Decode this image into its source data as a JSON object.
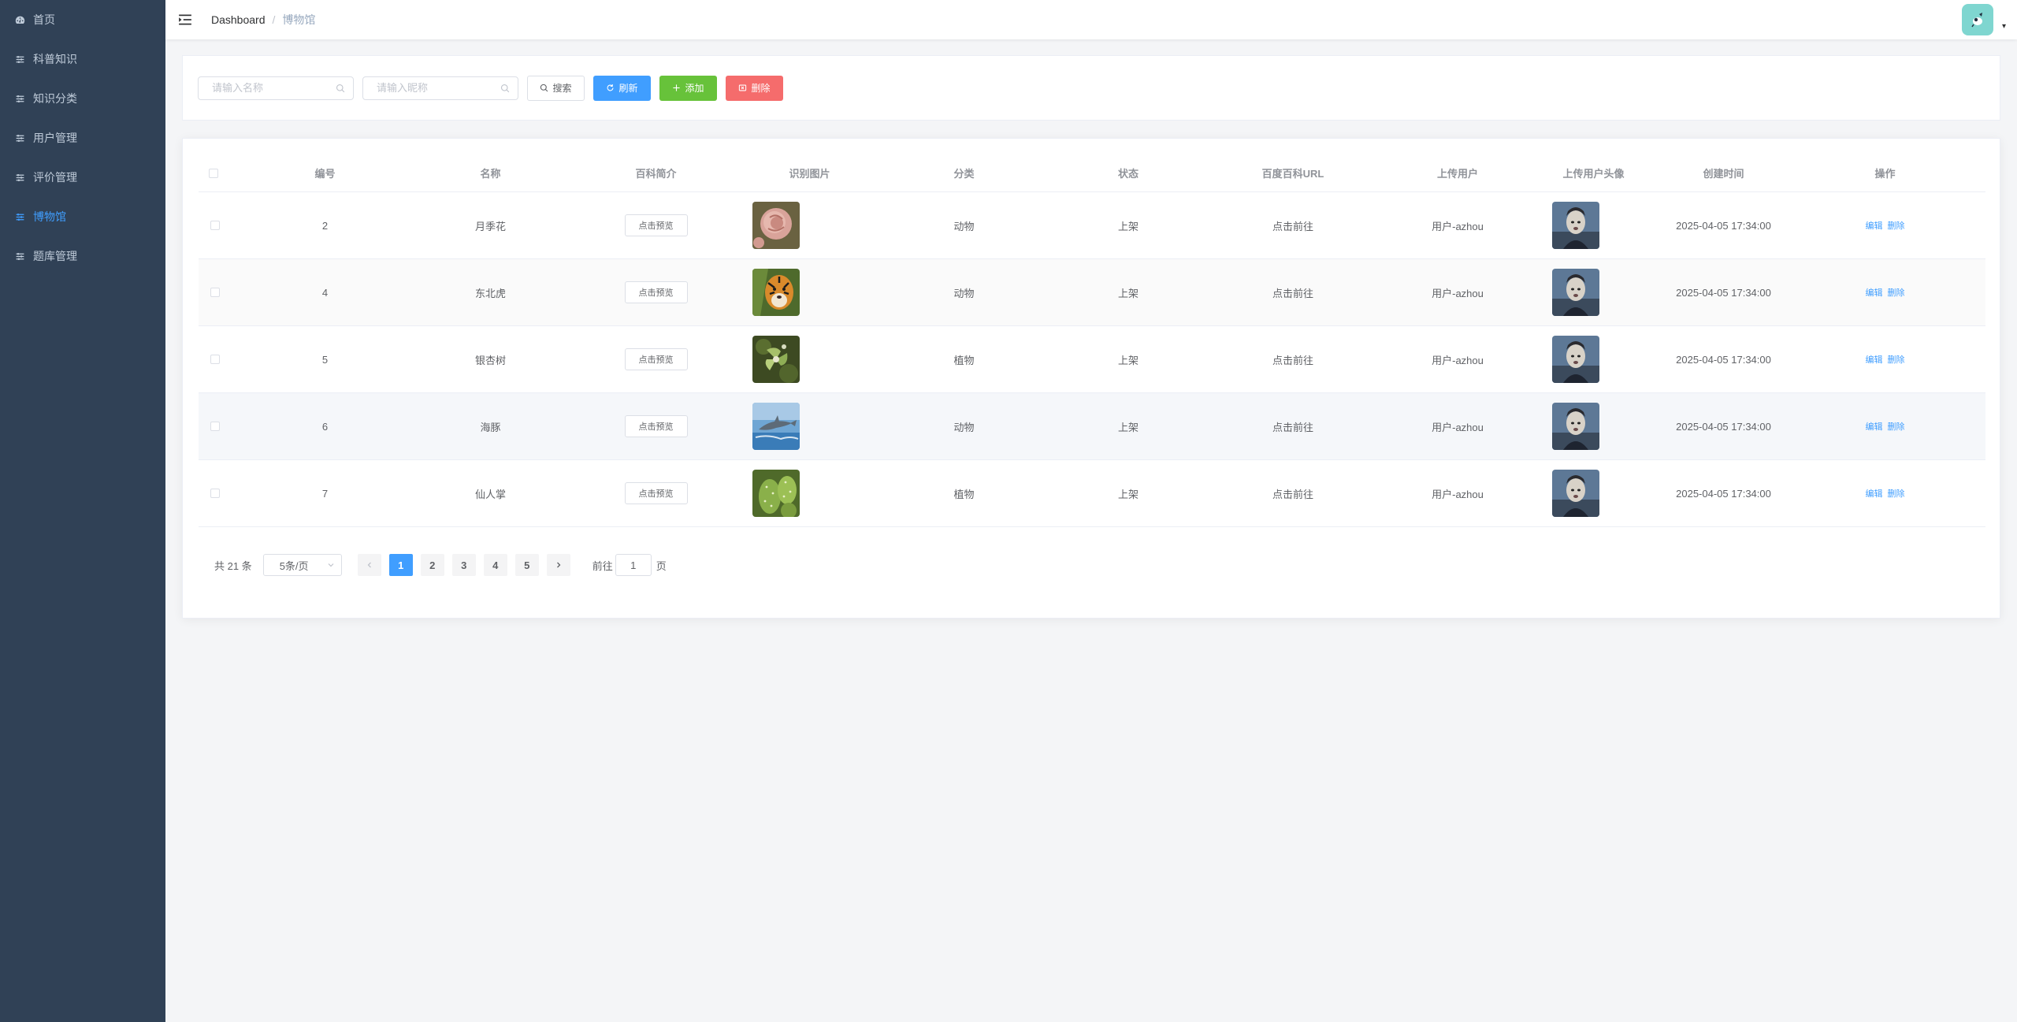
{
  "sidebar": {
    "items": [
      {
        "label": "首页",
        "icon": "dashboard-icon",
        "active": false
      },
      {
        "label": "科普知识",
        "icon": "menu-icon",
        "active": false
      },
      {
        "label": "知识分类",
        "icon": "menu-icon",
        "active": false
      },
      {
        "label": "用户管理",
        "icon": "menu-icon",
        "active": false
      },
      {
        "label": "评价管理",
        "icon": "menu-icon",
        "active": false
      },
      {
        "label": "博物馆",
        "icon": "menu-icon",
        "active": true
      },
      {
        "label": "题库管理",
        "icon": "menu-icon",
        "active": false
      }
    ]
  },
  "header": {
    "breadcrumb_home": "Dashboard",
    "breadcrumb_sep": "/",
    "breadcrumb_current": "博物馆",
    "avatar_caret": "▾"
  },
  "search": {
    "name_placeholder": "请输入名称",
    "nickname_placeholder": "请输入昵称",
    "search_label": "搜索",
    "refresh_label": "刷新",
    "add_label": "添加",
    "delete_label": "删除"
  },
  "table": {
    "headers": {
      "id": "编号",
      "name": "名称",
      "intro": "百科简介",
      "image": "识别图片",
      "category": "分类",
      "status": "状态",
      "url": "百度百科URL",
      "uploader": "上传用户",
      "uploader_avatar": "上传用户头像",
      "created": "创建时间",
      "ops": "操作"
    },
    "rows": [
      {
        "id": "2",
        "name": "月季花",
        "intro_btn": "点击预览",
        "image": "rose",
        "category": "动物",
        "status": "上架",
        "url": "点击前往",
        "uploader": "用户-azhou",
        "created": "2025-04-05 17:34:00",
        "edit": "编辑",
        "delete": "删除"
      },
      {
        "id": "4",
        "name": "东北虎",
        "intro_btn": "点击预览",
        "image": "tiger",
        "category": "动物",
        "status": "上架",
        "url": "点击前往",
        "uploader": "用户-azhou",
        "created": "2025-04-05 17:34:00",
        "edit": "编辑",
        "delete": "删除"
      },
      {
        "id": "5",
        "name": "银杏树",
        "intro_btn": "点击预览",
        "image": "ginkgo",
        "category": "植物",
        "status": "上架",
        "url": "点击前往",
        "uploader": "用户-azhou",
        "created": "2025-04-05 17:34:00",
        "edit": "编辑",
        "delete": "删除"
      },
      {
        "id": "6",
        "name": "海豚",
        "intro_btn": "点击预览",
        "image": "dolphin",
        "category": "动物",
        "status": "上架",
        "url": "点击前往",
        "uploader": "用户-azhou",
        "created": "2025-04-05 17:34:00",
        "edit": "编辑",
        "delete": "删除"
      },
      {
        "id": "7",
        "name": "仙人掌",
        "intro_btn": "点击预览",
        "image": "cactus",
        "category": "植物",
        "status": "上架",
        "url": "点击前往",
        "uploader": "用户-azhou",
        "created": "2025-04-05 17:34:00",
        "edit": "编辑",
        "delete": "删除"
      }
    ]
  },
  "pagination": {
    "total": "共 21 条",
    "page_size": "5条/页",
    "pages": [
      "1",
      "2",
      "3",
      "4",
      "5"
    ],
    "current": "1",
    "goto_prefix": "前往",
    "goto_value": "1",
    "goto_suffix": "页"
  },
  "colors": {
    "sidebar_bg": "#304156",
    "sidebar_text": "#bfcbd9",
    "active": "#409eff",
    "success": "#67c23a",
    "danger": "#f56c6c"
  }
}
